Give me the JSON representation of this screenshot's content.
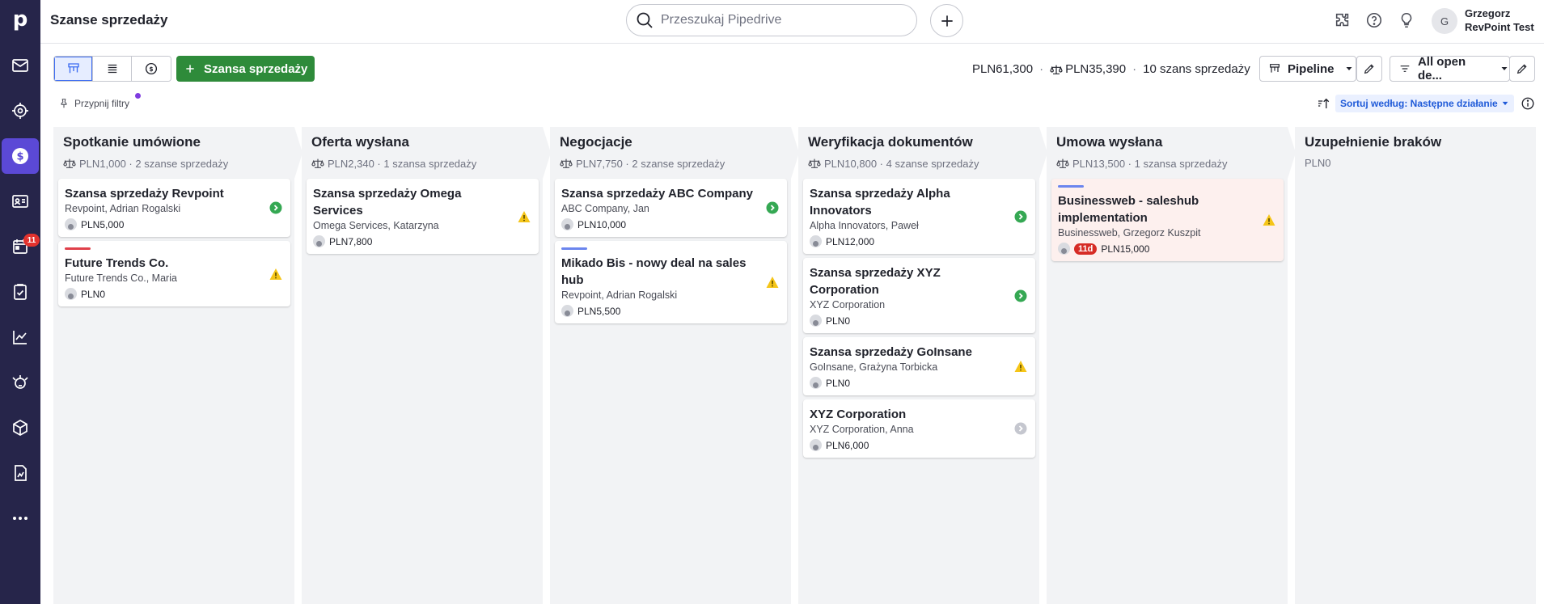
{
  "header": {
    "title": "Szanse sprzedaży",
    "search_placeholder": "Przeszukaj Pipedrive",
    "user_name": "Grzegorz",
    "company_name": "RevPoint Test",
    "avatar_initial": "G"
  },
  "sidebar": {
    "logo": "p",
    "items": [
      {
        "name": "mail-icon"
      },
      {
        "name": "target-icon"
      },
      {
        "name": "deals-icon",
        "active": true
      },
      {
        "name": "contacts-icon"
      },
      {
        "name": "calendar-icon",
        "badge": "11"
      },
      {
        "name": "tasks-icon"
      },
      {
        "name": "insights-icon"
      },
      {
        "name": "marketplace-icon"
      },
      {
        "name": "products-icon"
      },
      {
        "name": "reports-icon"
      },
      {
        "name": "more-icon"
      }
    ]
  },
  "toolbar": {
    "add_deal_label": "Szansa sprzedaży",
    "summary_total": "PLN61,300",
    "summary_weighted": "PLN35,390",
    "summary_count": "10 szans sprzedaży",
    "pipeline_label": "Pipeline",
    "filter_label": "All open de...",
    "pin_filters_label": "Przypnij filtry",
    "sort_label": "Sortuj według: Następne działanie"
  },
  "colors": {
    "sidebar_bg": "#26254a",
    "active_item": "#5b49d6",
    "add_deal_green": "#2e8b3a",
    "status_green": "#35a853",
    "status_warning": "#f5c518",
    "overdue_red": "#d62c26",
    "bar_red": "#e0404a",
    "bar_blue": "#6b85ee"
  },
  "stages": [
    {
      "name": "Spotkanie umówione",
      "meta": "PLN1,000 · 2 szanse sprzedaży",
      "weighted": true,
      "cards": [
        {
          "title": "Szansa sprzedaży Revpoint",
          "sub": "Revpoint, Adrian Rogalski",
          "value": "PLN5,000",
          "status": "green"
        },
        {
          "title": "Future Trends Co.",
          "sub": "Future Trends Co., Maria",
          "value": "PLN0",
          "status": "warning",
          "bar": "red"
        }
      ]
    },
    {
      "name": "Oferta wysłana",
      "meta": "PLN2,340 · 1 szansa sprzedaży",
      "weighted": true,
      "cards": [
        {
          "title": "Szansa sprzedaży Omega Services",
          "sub": "Omega Services, Katarzyna",
          "value": "PLN7,800",
          "status": "warning"
        }
      ]
    },
    {
      "name": "Negocjacje",
      "meta": "PLN7,750 · 2 szanse sprzedaży",
      "weighted": true,
      "cards": [
        {
          "title": "Szansa sprzedaży ABC Company",
          "sub": "ABC Company, Jan",
          "value": "PLN10,000",
          "status": "green"
        },
        {
          "title": "Mikado Bis - nowy deal na sales hub",
          "sub": "Revpoint, Adrian Rogalski",
          "value": "PLN5,500",
          "status": "warning",
          "bar": "blue"
        }
      ]
    },
    {
      "name": "Weryfikacja dokumentów",
      "meta": "PLN10,800 · 4 szanse sprzedaży",
      "weighted": true,
      "cards": [
        {
          "title": "Szansa sprzedaży Alpha Innovators",
          "sub": "Alpha Innovators, Paweł",
          "value": "PLN12,000",
          "status": "green"
        },
        {
          "title": "Szansa sprzedaży XYZ Corporation",
          "sub": "XYZ Corporation",
          "value": "PLN0",
          "status": "green"
        },
        {
          "title": "Szansa sprzedaży GoInsane",
          "sub": "GoInsane, Grażyna Torbicka",
          "value": "PLN0",
          "status": "warning"
        },
        {
          "title": "XYZ Corporation",
          "sub": "XYZ Corporation, Anna",
          "value": "PLN6,000",
          "status": "grey"
        }
      ]
    },
    {
      "name": "Umowa wysłana",
      "meta": "PLN13,500 · 1 szansa sprzedaży",
      "weighted": true,
      "cards": [
        {
          "title": "Businessweb - saleshub implementation",
          "sub": "Businessweb, Grzegorz Kuszpit",
          "value": "PLN15,000",
          "status": "warning",
          "bar": "blue",
          "overdue": "11d",
          "tinted": true
        }
      ]
    },
    {
      "name": "Uzupełnienie braków",
      "meta": "PLN0",
      "weighted": false,
      "cards": []
    }
  ]
}
